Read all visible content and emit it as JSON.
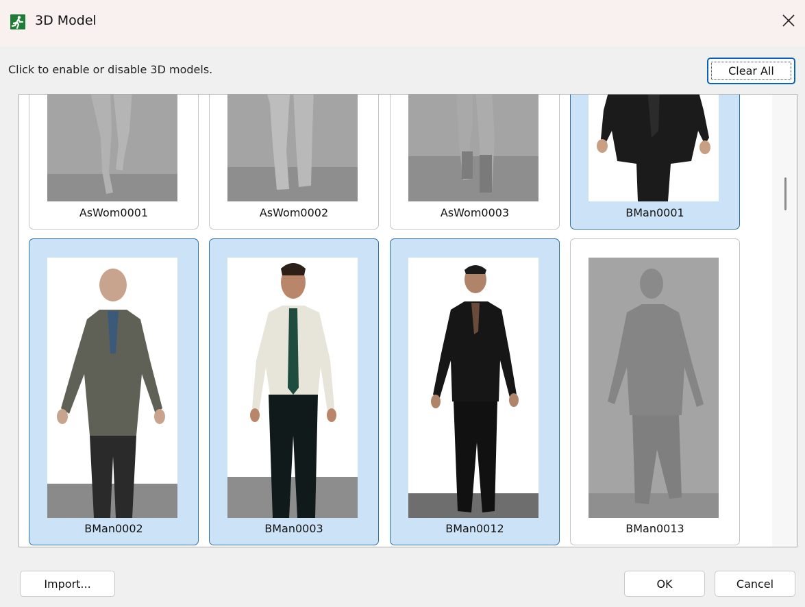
{
  "window": {
    "title": "3D Model",
    "icon": "running-man-icon",
    "close_icon": "close-icon"
  },
  "instruction": "Click to enable or disable 3D models.",
  "toolbar": {
    "clear_all_label": "Clear All"
  },
  "models": [
    {
      "name": "AsWom0001",
      "enabled": false
    },
    {
      "name": "AsWom0002",
      "enabled": false
    },
    {
      "name": "AsWom0003",
      "enabled": false
    },
    {
      "name": "BMan0001",
      "enabled": true
    },
    {
      "name": "BMan0002",
      "enabled": true
    },
    {
      "name": "BMan0003",
      "enabled": true
    },
    {
      "name": "BMan0012",
      "enabled": true
    },
    {
      "name": "BMan0013",
      "enabled": false
    }
  ],
  "footer": {
    "import_label": "Import...",
    "ok_label": "OK",
    "cancel_label": "Cancel"
  },
  "colors": {
    "selected_bg": "#cce3f7",
    "selected_border": "#2f6fa8",
    "disabled_thumb": "#a4a4a4",
    "accent": "#0a62b8"
  }
}
